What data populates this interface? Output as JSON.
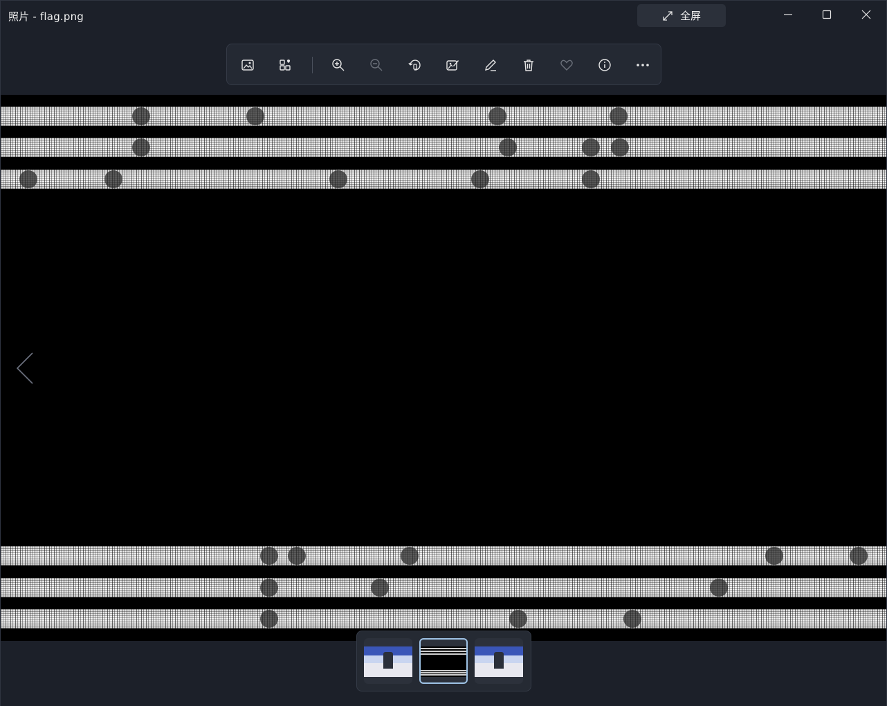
{
  "window": {
    "title": "照片 - flag.png",
    "fullscreen_label": "全屏",
    "controls": [
      "minimize-icon",
      "maximize-icon",
      "close-icon"
    ]
  },
  "toolbar": {
    "tools": [
      {
        "name": "view-image-icon",
        "enabled": true
      },
      {
        "name": "add-to-album-icon",
        "enabled": true
      },
      {
        "name": "zoom-in-icon",
        "enabled": true
      },
      {
        "name": "zoom-out-icon",
        "enabled": false
      },
      {
        "name": "rotate-icon",
        "enabled": true
      },
      {
        "name": "edit-image-icon",
        "enabled": true
      },
      {
        "name": "draw-icon",
        "enabled": true
      },
      {
        "name": "delete-icon",
        "enabled": true
      },
      {
        "name": "favorite-icon",
        "enabled": false
      },
      {
        "name": "info-icon",
        "enabled": true
      },
      {
        "name": "more-icon",
        "enabled": true
      }
    ]
  },
  "viewer": {
    "image_file": "flag.png",
    "prev_arrow": "chevron-left-icon"
  },
  "filmstrip": {
    "thumbnails": [
      {
        "kind": "photo",
        "selected": false
      },
      {
        "kind": "flag",
        "selected": true
      },
      {
        "kind": "photo",
        "selected": false
      }
    ]
  },
  "colors": {
    "background": "#1c2029",
    "toolbar": "#242933",
    "selected_border": "#9fc3e6",
    "icon": "#e6e6e6",
    "icon_disabled": "#6b707a"
  }
}
